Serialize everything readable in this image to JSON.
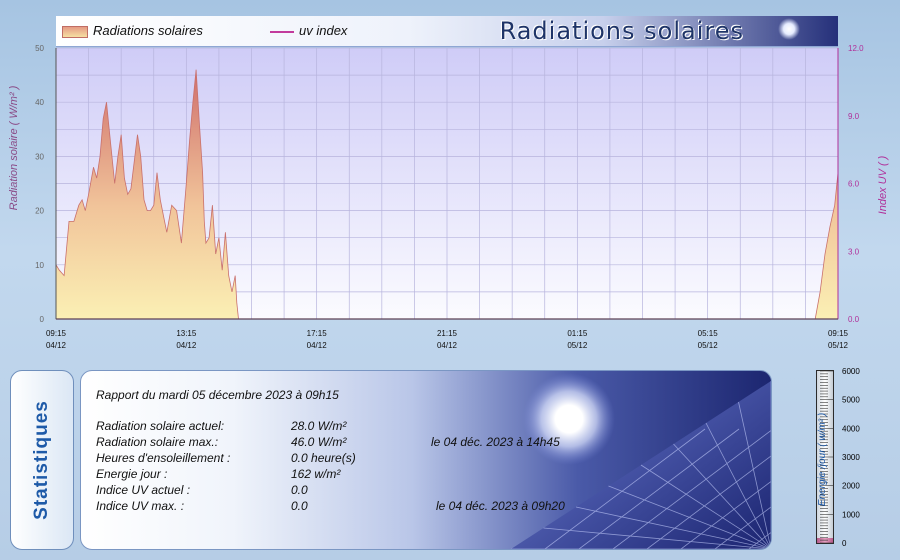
{
  "chart_data": {
    "type": "area",
    "title": "Radiations solaires",
    "ylabel": "Radiation solaire ( W/m² )",
    "y2label": "Index UV (  )",
    "ylim": [
      0,
      50
    ],
    "y2lim": [
      0,
      12
    ],
    "yticks": [
      "0",
      "10",
      "20",
      "30",
      "40",
      "50"
    ],
    "y2ticks": [
      "0.0",
      "3.0",
      "6.0",
      "9.0",
      "12.0"
    ],
    "xticks": [
      {
        "time": "09:15",
        "date": "04/12"
      },
      {
        "time": "13:15",
        "date": "04/12"
      },
      {
        "time": "17:15",
        "date": "04/12"
      },
      {
        "time": "21:15",
        "date": "04/12"
      },
      {
        "time": "01:15",
        "date": "05/12"
      },
      {
        "time": "05:15",
        "date": "05/12"
      },
      {
        "time": "09:15",
        "date": "05/12"
      }
    ],
    "grid": true,
    "legend_position": "top-left",
    "series": [
      {
        "name": "Radiations solaires",
        "axis": "left",
        "color": "#e08a7c",
        "points": [
          [
            0.0,
            10
          ],
          [
            0.1,
            9
          ],
          [
            0.25,
            8
          ],
          [
            0.4,
            18
          ],
          [
            0.55,
            18
          ],
          [
            0.7,
            21
          ],
          [
            0.8,
            22
          ],
          [
            0.9,
            20
          ],
          [
            1.0,
            23
          ],
          [
            1.15,
            28
          ],
          [
            1.25,
            26
          ],
          [
            1.35,
            30
          ],
          [
            1.45,
            37
          ],
          [
            1.55,
            40
          ],
          [
            1.6,
            37
          ],
          [
            1.7,
            31
          ],
          [
            1.8,
            25
          ],
          [
            1.9,
            30
          ],
          [
            2.0,
            34
          ],
          [
            2.1,
            26
          ],
          [
            2.2,
            23
          ],
          [
            2.3,
            24
          ],
          [
            2.4,
            29
          ],
          [
            2.5,
            34
          ],
          [
            2.6,
            30
          ],
          [
            2.7,
            22
          ],
          [
            2.8,
            20
          ],
          [
            2.9,
            20
          ],
          [
            3.0,
            21
          ],
          [
            3.1,
            27
          ],
          [
            3.2,
            22
          ],
          [
            3.3,
            19
          ],
          [
            3.4,
            16
          ],
          [
            3.55,
            21
          ],
          [
            3.7,
            20
          ],
          [
            3.85,
            14
          ],
          [
            4.0,
            25
          ],
          [
            4.1,
            33
          ],
          [
            4.2,
            40
          ],
          [
            4.3,
            46
          ],
          [
            4.4,
            36
          ],
          [
            4.5,
            27
          ],
          [
            4.55,
            18
          ],
          [
            4.6,
            14
          ],
          [
            4.7,
            15
          ],
          [
            4.8,
            21
          ],
          [
            4.9,
            12
          ],
          [
            5.0,
            15
          ],
          [
            5.1,
            9
          ],
          [
            5.2,
            16
          ],
          [
            5.3,
            8
          ],
          [
            5.4,
            5
          ],
          [
            5.5,
            8
          ],
          [
            5.55,
            3
          ],
          [
            5.6,
            0
          ],
          [
            23.3,
            0
          ],
          [
            23.45,
            5
          ],
          [
            23.6,
            12
          ],
          [
            23.75,
            17
          ],
          [
            23.9,
            21
          ],
          [
            24.0,
            27
          ]
        ]
      },
      {
        "name": "uv index",
        "axis": "right",
        "color": "#c23a9c",
        "points": [
          [
            0.0,
            0.0
          ],
          [
            24.0,
            0.0
          ]
        ]
      }
    ]
  },
  "stats": {
    "tab_label": "Statistiques",
    "report_title": "Rapport du mardi 05 décembre 2023 à 09h15",
    "rows": [
      {
        "label": "Radiation solaire actuel:",
        "value": "28.0 W/m²",
        "extra": ""
      },
      {
        "label": "Radiation solaire max.:",
        "value": "46.0 W/m²",
        "extra": "le 04 déc. 2023 à 14h45"
      },
      {
        "label": "Heures d'ensoleillement :",
        "value": "0.0 heure(s)",
        "extra": ""
      },
      {
        "label": "Energie jour :",
        "value": "162 w/m²",
        "extra": ""
      },
      {
        "label": "Indice UV actuel :",
        "value": "0.0",
        "extra": ""
      },
      {
        "label": "Indice UV max. :",
        "value": "0.0",
        "extra": "le 04 déc. 2023 à 09h20"
      }
    ]
  },
  "gauge": {
    "label": "Energie /jour ( w/m² )",
    "value": 162,
    "max": 6000,
    "ticks": [
      "6000",
      "5000",
      "4000",
      "3000",
      "2000",
      "1000",
      "0"
    ]
  }
}
